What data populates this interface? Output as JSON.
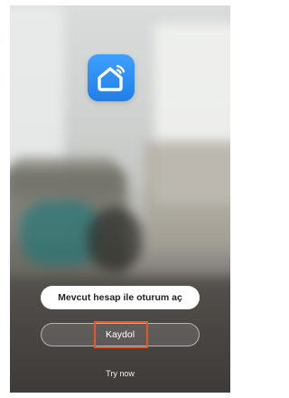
{
  "app": {
    "icon": "smart-home-wifi-icon",
    "accent_color": "#2a8cf2"
  },
  "buttons": {
    "login_label": "Mevcut hesap ile oturum aç",
    "register_label": "Kaydol",
    "try_now_label": "Try now"
  },
  "highlight_color": "#e8552a"
}
